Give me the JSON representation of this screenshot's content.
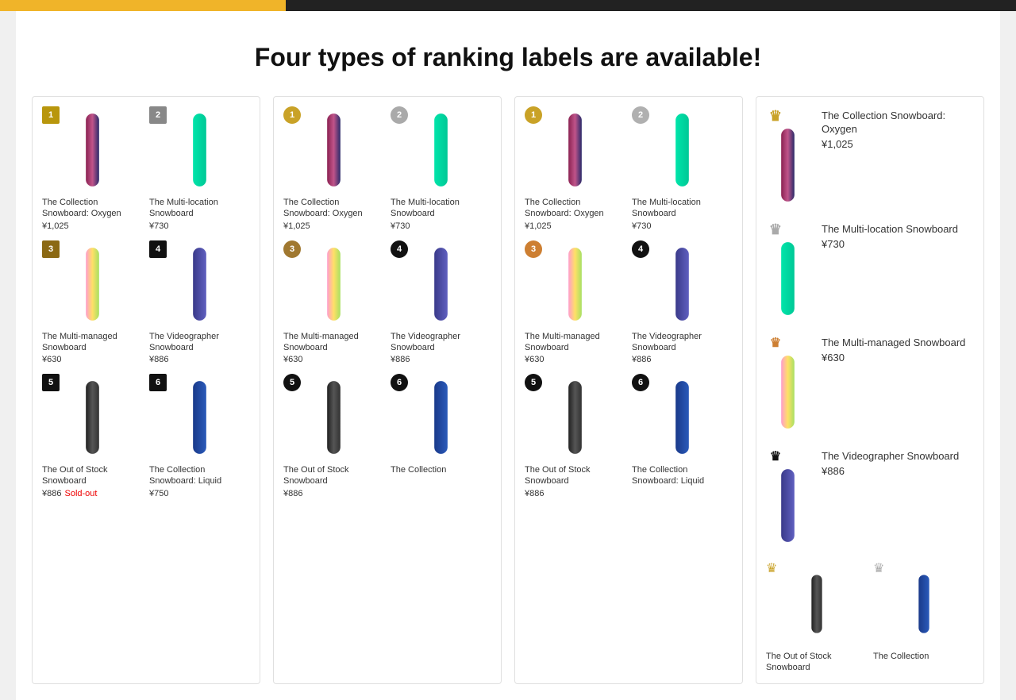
{
  "page": {
    "title": "Four types of ranking labels are available!"
  },
  "panels": [
    {
      "id": "panel-square",
      "type": "square",
      "products": [
        {
          "rank": 1,
          "badge_style": "square-gold",
          "name": "The Collection Snowboard: Oxygen",
          "price": "¥1,025",
          "board": "oxygen"
        },
        {
          "rank": 2,
          "badge_style": "square-gray",
          "name": "The Multi-location Snowboard",
          "price": "¥730",
          "board": "multi"
        },
        {
          "rank": 3,
          "badge_style": "square-bronze",
          "name": "The Multi-managed Snowboard",
          "price": "¥630",
          "board": "managed"
        },
        {
          "rank": 4,
          "badge_style": "square-dark",
          "name": "The Videographer Snowboard",
          "price": "¥886",
          "board": "videographer"
        },
        {
          "rank": 5,
          "badge_style": "square-dark5",
          "name": "The Out of Stock Snowboard",
          "price": "¥886",
          "sold_out": true,
          "board": "outofstock"
        },
        {
          "rank": 6,
          "badge_style": "square-dark6",
          "name": "The Collection Snowboard: Liquid",
          "price": "¥750",
          "board": "liquid"
        }
      ]
    },
    {
      "id": "panel-circle",
      "type": "circle",
      "products": [
        {
          "rank": 1,
          "badge_style": "circle-gold",
          "name": "The Collection Snowboard: Oxygen",
          "price": "¥1,025",
          "board": "oxygen"
        },
        {
          "rank": 2,
          "badge_style": "circle-gray",
          "name": "The Multi-location Snowboard",
          "price": "¥730",
          "board": "multi"
        },
        {
          "rank": 3,
          "badge_style": "circle-bronze",
          "name": "The Multi-managed Snowboard",
          "price": "¥630",
          "board": "managed"
        },
        {
          "rank": 4,
          "badge_style": "circle-dark",
          "name": "The Videographer Snowboard",
          "price": "¥886",
          "board": "videographer"
        },
        {
          "rank": 5,
          "badge_style": "circle-dark",
          "name": "The Out of Stock Snowboard",
          "price": "¥886",
          "board": "outofstock"
        },
        {
          "rank": 6,
          "badge_style": "circle-dark",
          "name": "The Collection",
          "price": "",
          "board": "liquid"
        }
      ]
    },
    {
      "id": "panel-coin",
      "type": "coin",
      "products": [
        {
          "rank": 1,
          "badge_style": "coin-gold",
          "name": "The Collection Snowboard: Oxygen",
          "price": "¥1,025",
          "board": "oxygen"
        },
        {
          "rank": 2,
          "badge_style": "coin-silver",
          "name": "The Multi-location Snowboard",
          "price": "¥730",
          "board": "multi"
        },
        {
          "rank": 3,
          "badge_style": "coin-bronze",
          "name": "The Multi-managed Snowboard",
          "price": "¥630",
          "board": "managed"
        },
        {
          "rank": 4,
          "badge_style": "coin-dark",
          "name": "The Videographer Snowboard",
          "price": "¥886",
          "board": "videographer"
        },
        {
          "rank": 5,
          "badge_style": "coin-dark",
          "name": "The Out of Stock Snowboard",
          "price": "¥886",
          "board": "outofstock"
        },
        {
          "rank": 6,
          "badge_style": "coin-dark",
          "name": "The Collection Snowboard: Liquid",
          "price": "",
          "board": "liquid"
        }
      ]
    },
    {
      "id": "panel-crown",
      "type": "crown",
      "products": [
        {
          "rank": 1,
          "badge_style": "crown-gold",
          "badge_icon": "♛",
          "name": "The Collection Snowboard: Oxygen",
          "price": "¥1,025",
          "board": "oxygen"
        },
        {
          "rank": 2,
          "badge_style": "crown-silver",
          "badge_icon": "♛",
          "name": "The Multi-location Snowboard",
          "price": "¥730",
          "board": "multi"
        },
        {
          "rank": 3,
          "badge_style": "crown-bronze",
          "badge_icon": "♛",
          "name": "The Multi-managed Snowboard",
          "price": "¥630",
          "board": "managed"
        },
        {
          "rank": 4,
          "badge_style": "crown-dark",
          "badge_icon": "♛",
          "name": "The Videographer Snowboard",
          "price": "¥886",
          "board": "videographer"
        },
        {
          "rank": 5,
          "badge_style": "crown-gold",
          "badge_icon": "♛",
          "name": "The Out of Stock Snowboard",
          "price": "",
          "board": "outofstock"
        },
        {
          "rank": 6,
          "badge_style": "crown-silver",
          "badge_icon": "♛",
          "name": "The Collection",
          "price": "",
          "board": "liquid"
        }
      ]
    }
  ]
}
